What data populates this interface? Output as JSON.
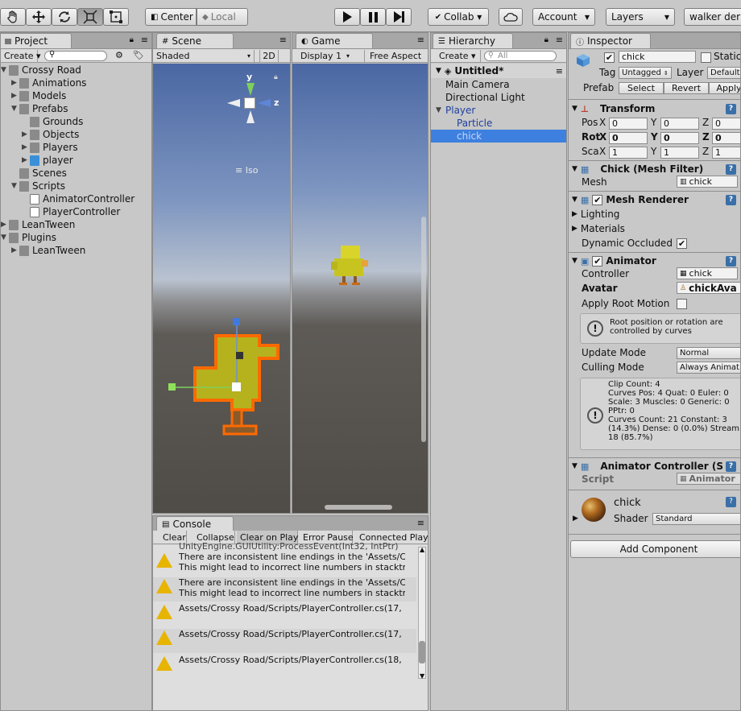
{
  "toolbar": {
    "center_label": "Center",
    "local_label": "Local",
    "collab_label": "Collab ▾",
    "account_label": "Account",
    "layers_label": "Layers",
    "layout_label": "walker der"
  },
  "project": {
    "tab": "Project",
    "create_label": "Create ▾",
    "tree": [
      {
        "label": "Crossy Road",
        "depth": 0,
        "arrow": "▼"
      },
      {
        "label": "Animations",
        "depth": 1,
        "arrow": "▶"
      },
      {
        "label": "Models",
        "depth": 1,
        "arrow": "▶"
      },
      {
        "label": "Prefabs",
        "depth": 1,
        "arrow": "▼"
      },
      {
        "label": "Grounds",
        "depth": 2,
        "arrow": ""
      },
      {
        "label": "Objects",
        "depth": 2,
        "arrow": "▶"
      },
      {
        "label": "Players",
        "depth": 2,
        "arrow": "▶"
      },
      {
        "label": "player",
        "depth": 2,
        "arrow": "▶"
      },
      {
        "label": "Scenes",
        "depth": 1,
        "arrow": ""
      },
      {
        "label": "Scripts",
        "depth": 1,
        "arrow": "▼"
      },
      {
        "label": "AnimatorController",
        "depth": 2,
        "arrow": ""
      },
      {
        "label": "PlayerController",
        "depth": 2,
        "arrow": ""
      },
      {
        "label": "LeanTween",
        "depth": 0,
        "arrow": "▶"
      },
      {
        "label": "Plugins",
        "depth": 0,
        "arrow": "▼"
      },
      {
        "label": "LeanTween",
        "depth": 1,
        "arrow": "▶"
      }
    ]
  },
  "scene": {
    "tab": "Scene",
    "shaded_label": "Shaded",
    "mode_2d_label": "2D",
    "gizmo_y": "y",
    "gizmo_z": "z",
    "iso_label": "Iso"
  },
  "game": {
    "tab": "Game",
    "display_label": "Display 1",
    "aspect_label": "Free Aspect"
  },
  "hierarchy": {
    "tab": "Hierarchy",
    "create_label": "Create ▾",
    "search_placeholder": "All",
    "scene_name": "Untitled*",
    "items": [
      {
        "label": "Main Camera",
        "depth": 1
      },
      {
        "label": "Directional Light",
        "depth": 1
      },
      {
        "label": "Player",
        "depth": 1,
        "arrow": "▼"
      },
      {
        "label": "Particle",
        "depth": 2
      },
      {
        "label": "chick",
        "depth": 2
      }
    ]
  },
  "console": {
    "tab": "Console",
    "buttons": [
      "Clear",
      "Collapse",
      "Clear on Play",
      "Error Pause",
      "Connected Playe"
    ],
    "cut_line": "UnityEngine.GUIUtility:ProcessEvent(Int32, IntPtr)",
    "messages": [
      {
        "line1": "There are inconsistent line endings in the 'Assets/C",
        "line2": "This might lead to incorrect line numbers in stacktra"
      },
      {
        "line1": "There are inconsistent line endings in the 'Assets/C",
        "line2": "This might lead to incorrect line numbers in stacktra"
      },
      {
        "line1": "Assets/Crossy Road/Scripts/PlayerController.cs(17,",
        "line2": ""
      },
      {
        "line1": "Assets/Crossy Road/Scripts/PlayerController.cs(17,",
        "line2": ""
      },
      {
        "line1": "Assets/Crossy Road/Scripts/PlayerController.cs(18,",
        "line2": ""
      }
    ]
  },
  "inspector": {
    "tab": "Inspector",
    "object_name": "chick",
    "static_label": "Static",
    "tag_label": "Tag",
    "tag_value": "Untagged",
    "layer_label": "Layer",
    "layer_value": "Default",
    "prefab_label": "Prefab",
    "select_label": "Select",
    "revert_label": "Revert",
    "apply_label": "Apply",
    "transform": {
      "title": "Transform",
      "pos_label": "Pos",
      "rot_label": "Rot",
      "scale_label": "Sca",
      "pos": [
        "0",
        "0",
        "0"
      ],
      "rot": [
        "0",
        "0",
        "0"
      ],
      "scale": [
        "1",
        "1",
        "1"
      ]
    },
    "mesh_filter": {
      "title": "Chick (Mesh Filter)",
      "mesh_label": "Mesh",
      "mesh_value": "chick"
    },
    "mesh_renderer": {
      "title": "Mesh Renderer",
      "lighting": "Lighting",
      "materials": "Materials",
      "dynamic_occluded": "Dynamic Occluded"
    },
    "animator": {
      "title": "Animator",
      "controller_label": "Controller",
      "controller_value": "chick",
      "avatar_label": "Avatar",
      "avatar_value": "chickAva",
      "apply_root_motion": "Apply Root Motion",
      "root_info": "Root position or rotation are controlled by curves",
      "update_mode_label": "Update Mode",
      "update_mode_value": "Normal",
      "culling_mode_label": "Culling Mode",
      "culling_mode_value": "Always Animat",
      "stats": [
        "Clip Count: 4",
        "Curves Pos: 4 Quat: 0 Euler: 0",
        "Scale: 3 Muscles: 0 Generic: 0",
        "PPtr: 0",
        "Curves Count: 21 Constant: 3",
        "(14.3%) Dense: 0 (0.0%) Stream",
        "18 (85.7%)"
      ]
    },
    "anim_controller": {
      "title": "Animator Controller (S",
      "script_label": "Script",
      "script_value": "Animator"
    },
    "material": {
      "name": "chick",
      "shader_label": "Shader",
      "shader_value": "Standard"
    },
    "add_component": "Add Component"
  }
}
